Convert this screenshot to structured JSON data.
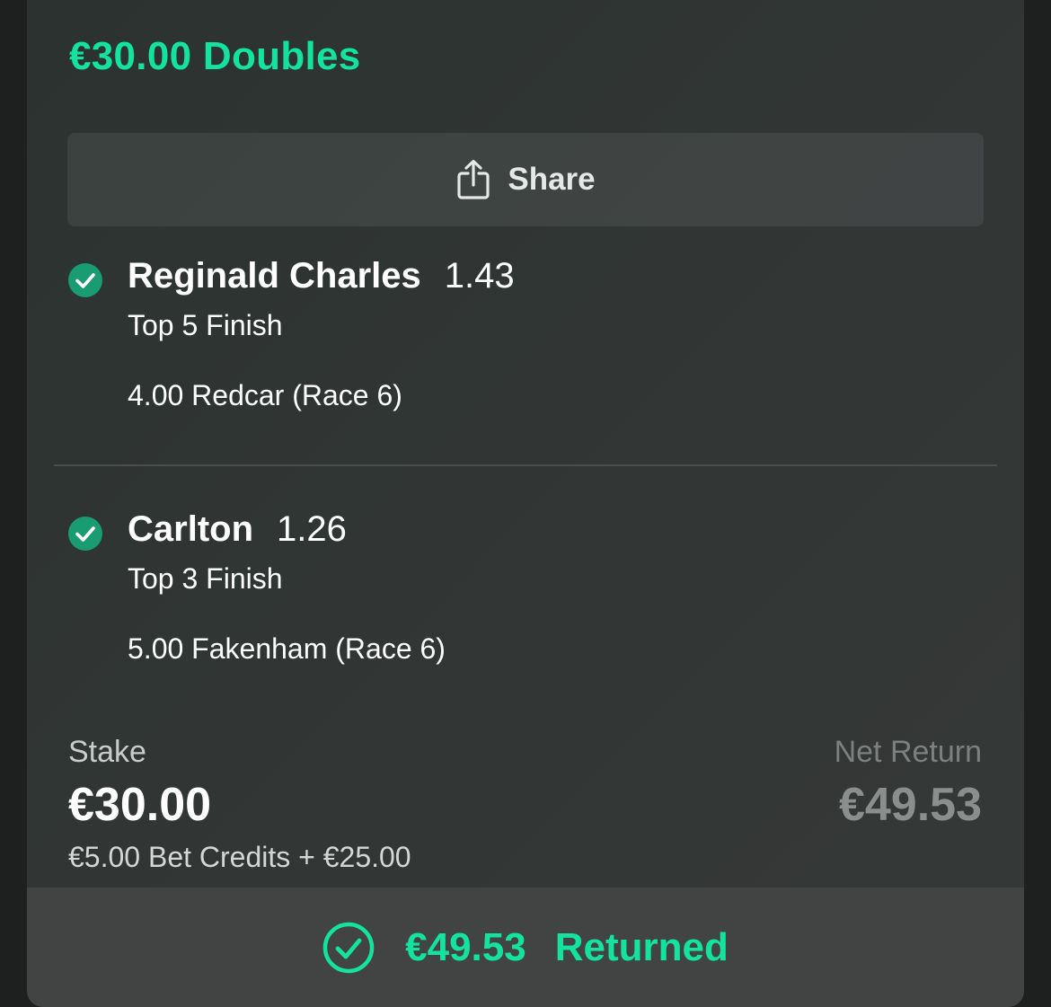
{
  "bet": {
    "title": "€30.00 Doubles"
  },
  "share": {
    "label": "Share",
    "icon": "share-icon"
  },
  "selections": [
    {
      "name": "Reginald Charles",
      "odds": "1.43",
      "market": "Top 5 Finish",
      "event": "4.00 Redcar (Race 6)",
      "status_icon": "check-circle-icon"
    },
    {
      "name": "Carlton",
      "odds": "1.26",
      "market": "Top 3 Finish",
      "event": "5.00 Fakenham (Race 6)",
      "status_icon": "check-circle-icon"
    }
  ],
  "stake": {
    "label": "Stake",
    "value": "€30.00",
    "detail": "€5.00 Bet Credits + €25.00"
  },
  "net_return": {
    "label": "Net Return",
    "value": "€49.53"
  },
  "result": {
    "amount": "€49.53",
    "label": "Returned",
    "icon": "check-circle-outline-icon"
  },
  "colors": {
    "accent": "#14e3a0",
    "check_fill": "#1a9c72",
    "background": "#313634",
    "result_bar": "#424443"
  }
}
